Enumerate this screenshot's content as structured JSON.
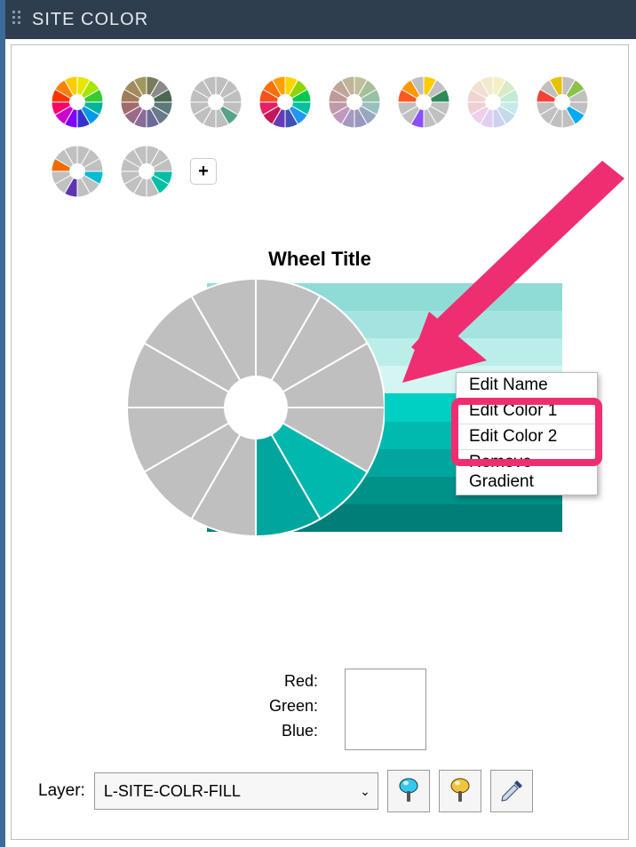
{
  "header": {
    "title": "SITE COLOR"
  },
  "thumbnails": [
    {
      "id": "full-color-wheel",
      "segments": [
        "#e6e600",
        "#a6e600",
        "#33cc33",
        "#00b3a1",
        "#0099e6",
        "#3333cc",
        "#8000ff",
        "#cc00cc",
        "#ff0066",
        "#ff3300",
        "#ff8000",
        "#ffcc00"
      ]
    },
    {
      "id": "earth-wheel",
      "segments": [
        "#7a7a5c",
        "#8a8a8a",
        "#4d6652",
        "#5c7a7a",
        "#6b7a8a",
        "#6b6b99",
        "#8a6b99",
        "#996b8a",
        "#a16b6b",
        "#a17a5c",
        "#a18a5c",
        "#a1995c"
      ]
    },
    {
      "id": "grey-green-wheel",
      "segments": [
        "#bfbfbf",
        "#bfbfbf",
        "#bfbfbf",
        "#bfbfbf",
        "#56a38c",
        "#bfbfbf",
        "#bfbfbf",
        "#bfbfbf",
        "#bfbfbf",
        "#bfbfbf",
        "#bfbfbf",
        "#bfbfbf"
      ]
    },
    {
      "id": "rainbow-bright-wheel",
      "segments": [
        "#ffd400",
        "#8fd400",
        "#00c853",
        "#00bfa5",
        "#2196f3",
        "#3f51b5",
        "#673ab7",
        "#c2185b",
        "#e91e63",
        "#f4511e",
        "#ff6f00",
        "#ffa000"
      ]
    },
    {
      "id": "muted-pastel-wheel",
      "segments": [
        "#bfbf99",
        "#a6bf99",
        "#99bfa6",
        "#99bfbf",
        "#99a6bf",
        "#9999bf",
        "#a699bf",
        "#bf99bf",
        "#bf99a6",
        "#bf9999",
        "#bfa699",
        "#bfb399"
      ]
    },
    {
      "id": "warm-wheel",
      "segments": [
        "#ffcc00",
        "#c0c0c0",
        "#2e8b57",
        "#c0c0c0",
        "#c0c0c0",
        "#c0c0c0",
        "#8a4fff",
        "#c0c0c0",
        "#c0c0c0",
        "#ff5722",
        "#ff9800",
        "#c0c0c0"
      ]
    },
    {
      "id": "pastel-wheel",
      "segments": [
        "#f5f0c4",
        "#d9eac4",
        "#c4ead4",
        "#c4eaea",
        "#c4d9ea",
        "#cfcff0",
        "#e0cff0",
        "#f0cfea",
        "#f0cfd4",
        "#f0d4cf",
        "#f0e0cf",
        "#f0eacf"
      ]
    },
    {
      "id": "split-wheel",
      "segments": [
        "#c0c0c0",
        "#8bc34a",
        "#c0c0c0",
        "#c0c0c0",
        "#03a9f4",
        "#c0c0c0",
        "#c0c0c0",
        "#c0c0c0",
        "#c0c0c0",
        "#f44336",
        "#c0c0c0",
        "#e6c200"
      ]
    },
    {
      "id": "diag-wheel",
      "segments": [
        "#c0c0c0",
        "#c0c0c0",
        "#c0c0c0",
        "#00bcd4",
        "#c0c0c0",
        "#c0c0c0",
        "#5e35b1",
        "#c0c0c0",
        "#c0c0c0",
        "#ef6c00",
        "#c0c0c0",
        "#c0c0c0"
      ]
    },
    {
      "id": "teal-slice-wheel",
      "segments": [
        "#c0c0c0",
        "#c0c0c0",
        "#c0c0c0",
        "#00bfa5",
        "#00bfa5",
        "#c0c0c0",
        "#c0c0c0",
        "#c0c0c0",
        "#c0c0c0",
        "#c0c0c0",
        "#c0c0c0",
        "#c0c0c0"
      ]
    }
  ],
  "add_label": "+",
  "wheel_title": "Wheel Title",
  "gradient_strips": [
    "#8fdcd7",
    "#a4e4e0",
    "#bceee9",
    "#d4f5f1",
    "#00cfc3",
    "#00bab0",
    "#00a69d",
    "#009189",
    "#007e77"
  ],
  "big_wheel": {
    "grey": "#bfbfbf",
    "teal_segments": [
      "#00b8ae",
      "#00a69d"
    ],
    "highlight_segment_index": 4
  },
  "context_menu": {
    "items": [
      "Edit Name",
      "Edit Color 1",
      "Edit Color 2",
      "Remove Gradient"
    ],
    "highlighted": [
      1,
      2
    ]
  },
  "rgb": {
    "red_label": "Red:",
    "green_label": "Green:",
    "blue_label": "Blue:"
  },
  "layer": {
    "label": "Layer:",
    "value": "L-SITE-COLR-FILL"
  },
  "tool_icons": {
    "pin_blue": "pin-blue-icon",
    "pin_yellow": "pin-yellow-icon",
    "eyedropper": "eyedropper-icon"
  },
  "annotation_arrow": {
    "color": "#ef2e72"
  }
}
